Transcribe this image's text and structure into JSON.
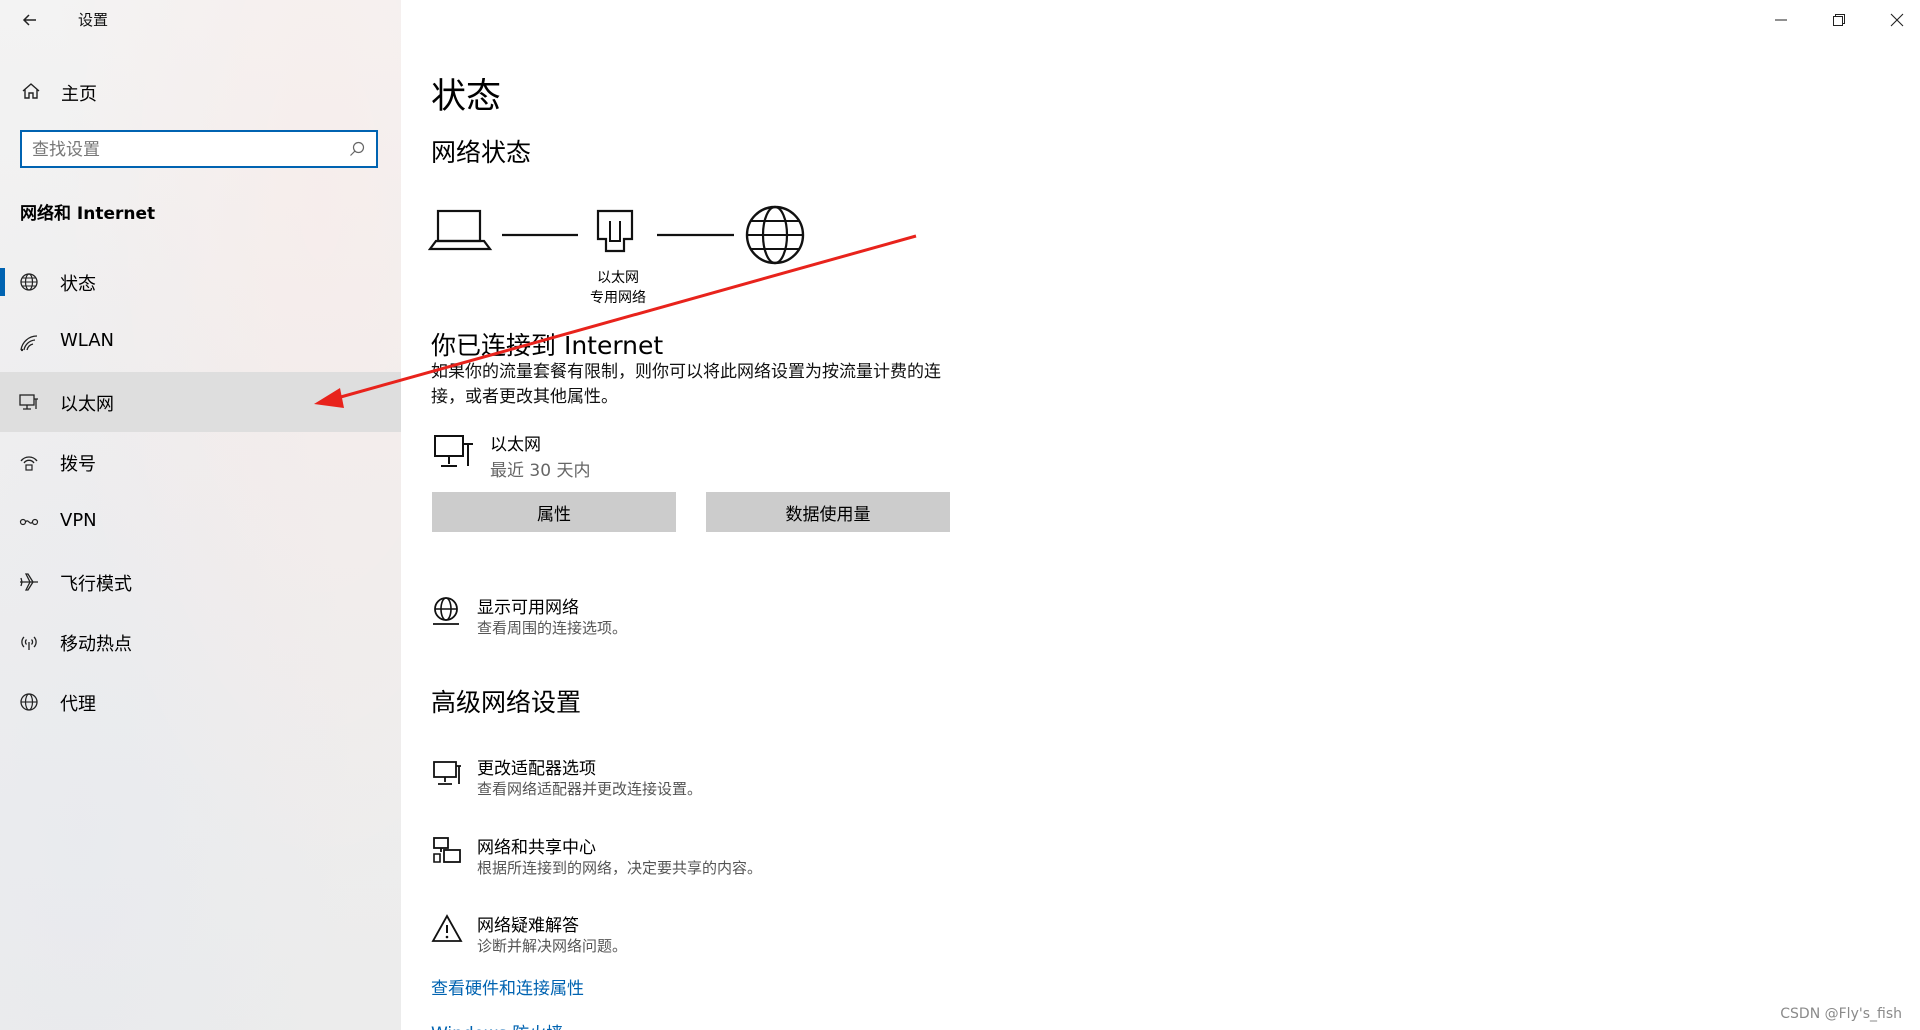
{
  "window": {
    "title": "设置",
    "controls": {
      "minimize": "minimize-icon",
      "restore": "restore-icon",
      "close": "close-icon"
    }
  },
  "sidebar": {
    "home_label": "主页",
    "search_placeholder": "查找设置",
    "section_title": "网络和 Internet",
    "items": [
      {
        "label": "状态",
        "icon": "globe-status-icon",
        "selected": false,
        "active_indicator": true
      },
      {
        "label": "WLAN",
        "icon": "wifi-icon",
        "selected": false
      },
      {
        "label": "以太网",
        "icon": "ethernet-icon",
        "selected": true
      },
      {
        "label": "拨号",
        "icon": "dialup-icon",
        "selected": false
      },
      {
        "label": "VPN",
        "icon": "vpn-icon",
        "selected": false
      },
      {
        "label": "飞行模式",
        "icon": "airplane-icon",
        "selected": false
      },
      {
        "label": "移动热点",
        "icon": "hotspot-icon",
        "selected": false
      },
      {
        "label": "代理",
        "icon": "globe-icon",
        "selected": false
      }
    ]
  },
  "main": {
    "title": "状态",
    "network_status_heading": "网络状态",
    "diagram": {
      "adapter_label": "以太网",
      "network_label": "专用网络"
    },
    "connected_title": "你已连接到 Internet",
    "connected_desc": "如果你的流量套餐有限制，则你可以将此网络设置为按流量计费的连接，或者更改其他属性。",
    "connection": {
      "name": "以太网",
      "usage": "最近 30 天内"
    },
    "buttons": {
      "properties": "属性",
      "data_usage": "数据使用量"
    },
    "show_networks": {
      "title": "显示可用网络",
      "subtitle": "查看周围的连接选项。"
    },
    "advanced_heading": "高级网络设置",
    "advanced_items": [
      {
        "title": "更改适配器选项",
        "subtitle": "查看网络适配器并更改连接设置。",
        "icon": "adapter-icon"
      },
      {
        "title": "网络和共享中心",
        "subtitle": "根据所连接到的网络，决定要共享的内容。",
        "icon": "sharing-center-icon"
      },
      {
        "title": "网络疑难解答",
        "subtitle": "诊断并解决网络问题。",
        "icon": "warning-icon"
      }
    ],
    "links": [
      "查看硬件和连接属性",
      "Windows 防火墙"
    ]
  },
  "watermark": "CSDN @Fly's_fish",
  "colors": {
    "accent": "#0063b1",
    "selected_bg": "#dedede",
    "button_bg": "#cccccc",
    "annotation_arrow": "#e8231c"
  }
}
